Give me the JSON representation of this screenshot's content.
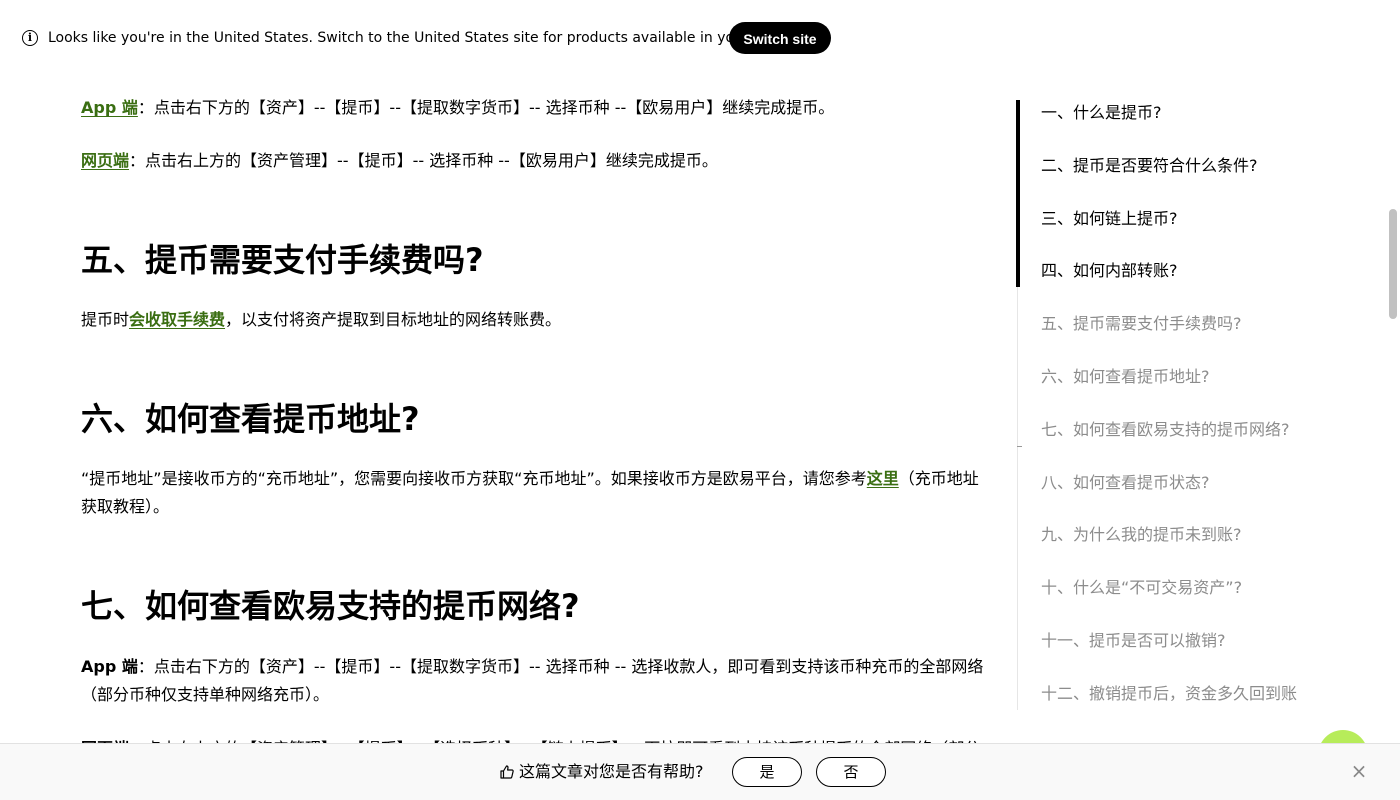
{
  "banner": {
    "info_icon": "info-icon",
    "text": "Looks like you're in the United States. Switch to the United States site for products available in your region.",
    "button": "Switch site"
  },
  "article": {
    "app_withdraw": {
      "link": "App 端",
      "text": "：点击右下方的【资产】--【提币】--【提取数字货币】-- 选择币种 --【欧易用户】继续完成提币。"
    },
    "web_withdraw": {
      "link": "网页端",
      "text": "：点击右上方的【资产管理】--【提币】-- 选择币种 --【欧易用户】继续完成提币。"
    },
    "h5": "五、提币需要支付手续费吗?",
    "fee": {
      "prefix": "提币时",
      "link": "会收取手续费",
      "suffix": "，以支付将资产提取到目标地址的网络转账费。"
    },
    "h6": "六、如何查看提币地址?",
    "address": {
      "prefix": "“提币地址”是接收币方的“充币地址”，您需要向接收币方获取“充币地址”。如果接收币方是欧易平台，请您参考",
      "link": "这里",
      "suffix": "（充币地址获取教程）。"
    },
    "h7": "七、如何查看欧易支持的提币网络?",
    "network_app": {
      "label": "App 端",
      "text": "：点击右下方的【资产】--【提币】--【提取数字货币】-- 选择币种 -- 选择收款人，即可看到支持该币种充币的全部网络（部分币种仅支持单种网络充币）。"
    },
    "network_web_partial": {
      "label": "网页端",
      "text": "：点击右上方的【资产管理】--【提币】--【选择币种】--【链上提币】-- 下拉即可看到支持该币种提币的全部网络（部分"
    }
  },
  "toc": {
    "items": [
      {
        "label": "一、什么是提币?",
        "active": true
      },
      {
        "label": "二、提币是否要符合什么条件?",
        "active": true
      },
      {
        "label": "三、如何链上提币?",
        "active": true
      },
      {
        "label": "四、如何内部转账?",
        "active": true
      },
      {
        "label": "五、提币需要支付手续费吗?",
        "active": false
      },
      {
        "label": "六、如何查看提币地址?",
        "active": false
      },
      {
        "label": "七、如何查看欧易支持的提币网络?",
        "active": false
      },
      {
        "label": "八、如何查看提币状态?",
        "active": false
      },
      {
        "label": "九、为什么我的提币未到账?",
        "active": false
      },
      {
        "label": "十、什么是“不可交易资产”?",
        "active": false
      },
      {
        "label": "十一、提币是否可以撤销?",
        "active": false
      },
      {
        "label": "十二、撤销提币后，资金多久回到账",
        "active": false
      }
    ]
  },
  "feedback": {
    "icon": "thumbs-up-icon",
    "question": "这篇文章对您是否有帮助?",
    "yes": "是",
    "no": "否",
    "close_icon": "close-icon"
  },
  "colors": {
    "link": "#3a6e12",
    "toc_inactive": "#8c8c8c",
    "accent_bubble": "#b7ec5a"
  }
}
